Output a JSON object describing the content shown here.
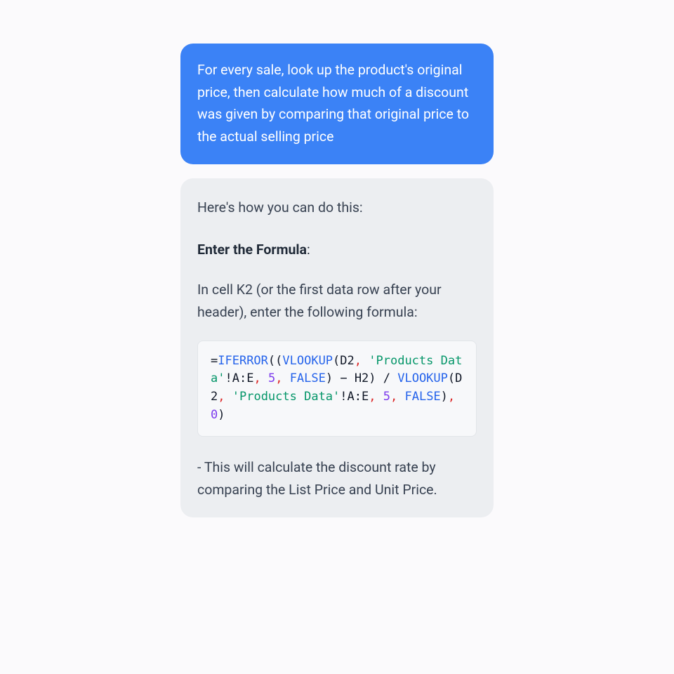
{
  "user_message": "For every sale, look up the product's original price, then calculate how much of a discount was given by comparing that original price to the actual selling price",
  "assistant": {
    "intro": "Here's how you can do this:",
    "heading": "Enter the Formula",
    "heading_colon": ":",
    "para": "In cell K2 (or the first data row after your header), enter the following formula:",
    "bullet": "- This will calculate the discount rate by comparing the List Price and Unit Price."
  },
  "formula": {
    "t1": "=",
    "t2": "IFERROR",
    "t3": "((",
    "t4": "VLOOKUP",
    "t5": "(D2",
    "t6": ",",
    "t7": " ",
    "t8": "'Products Data'",
    "t9": "!A:E",
    "t10": ",",
    "t11": " ",
    "t12": "5",
    "t13": ",",
    "t14": " ",
    "t15": "FALSE",
    "t16": ") − H2) / ",
    "t17": "VLOOKUP",
    "t18": "(D2",
    "t19": ",",
    "t20": " ",
    "t21": "'Products Data'",
    "t22": "!A:E",
    "t23": ",",
    "t24": " ",
    "t25": "5",
    "t26": ",",
    "t27": " ",
    "t28": "FALSE",
    "t29": ")",
    "t30": ",",
    "t31": " ",
    "t32": "0",
    "t33": ")"
  }
}
